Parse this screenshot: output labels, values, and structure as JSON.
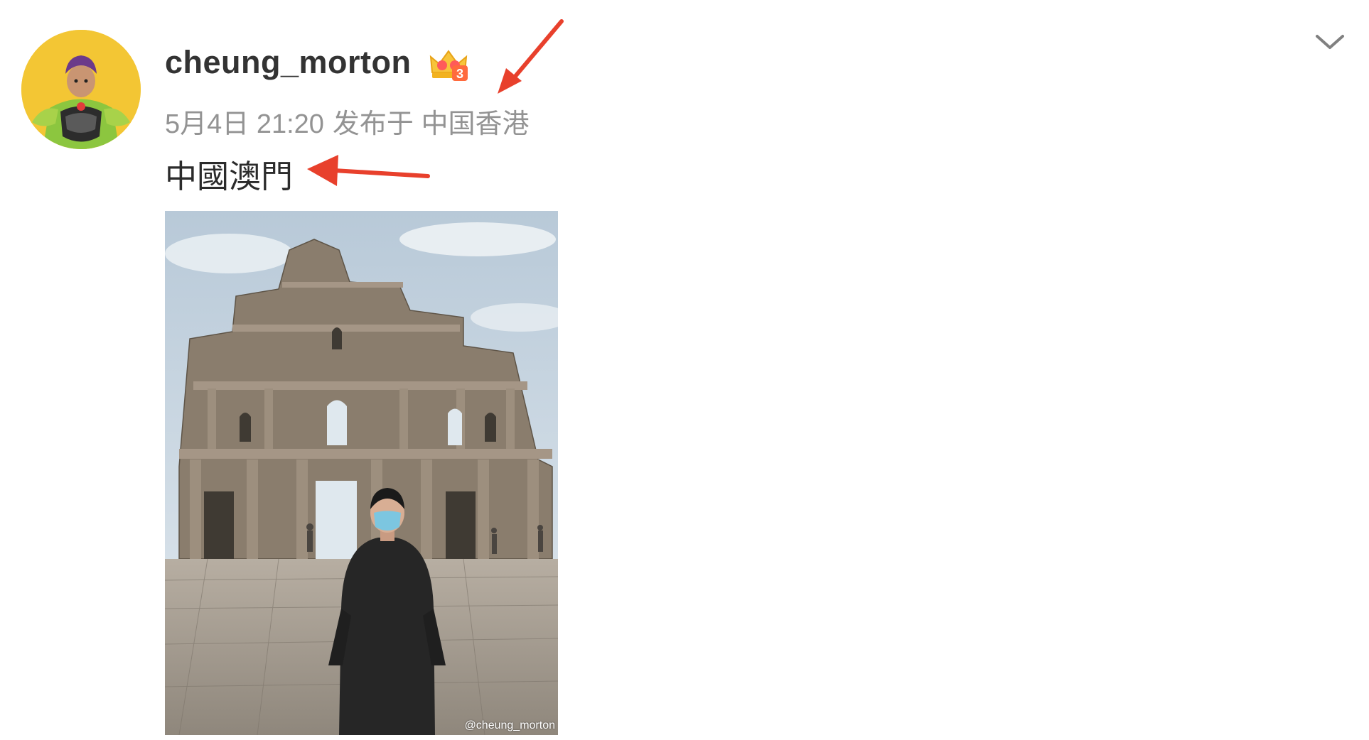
{
  "post": {
    "author": {
      "username": "cheung_morton",
      "avatar_icon": "avatar-kid-in-costume",
      "badge_icon": "vip-crown-badge",
      "badge_level": "3"
    },
    "meta": {
      "date": "5月4日 21:20",
      "posted_from": "发布于 中国香港"
    },
    "text": "中國澳門",
    "image": {
      "watermark": "@cheung_morton"
    },
    "menu_icon": "chevron-down-icon"
  },
  "annotations": {
    "arrow_color": "#e8402c"
  }
}
